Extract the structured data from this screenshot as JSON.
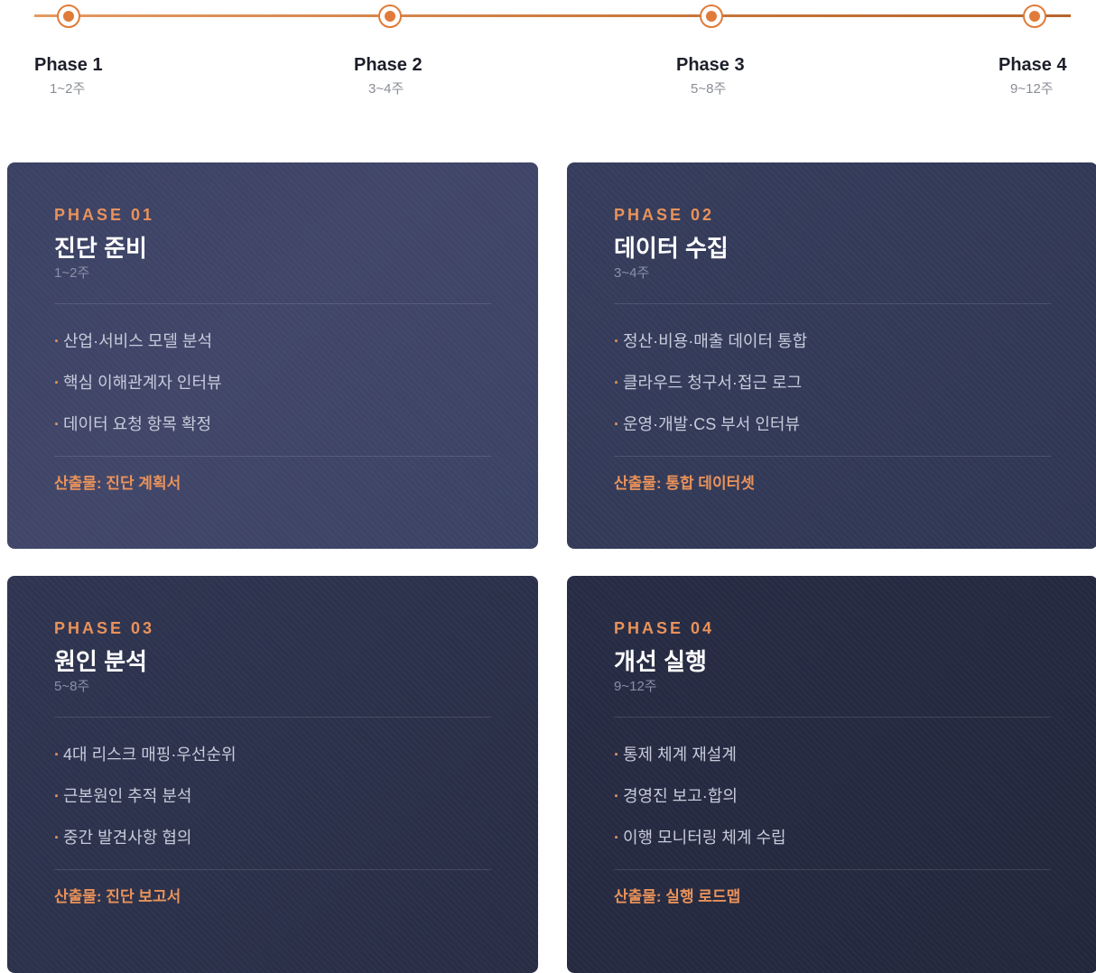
{
  "timeline": {
    "phases": [
      {
        "label": "Phase 1",
        "range": "1~2주"
      },
      {
        "label": "Phase 2",
        "range": "3~4주"
      },
      {
        "label": "Phase 3",
        "range": "5~8주"
      },
      {
        "label": "Phase 4",
        "range": "9~12주"
      }
    ],
    "accent_color": "#e07b39"
  },
  "cards": [
    {
      "tag": "PHASE 01",
      "title": "진단 준비",
      "weeks": "1~2주",
      "items": [
        "산업·서비스 모델 분석",
        "핵심 이해관계자 인터뷰",
        "데이터 요청 항목 확정"
      ],
      "deliverable": "산출물: 진단 계획서"
    },
    {
      "tag": "PHASE 02",
      "title": "데이터 수집",
      "weeks": "3~4주",
      "items": [
        "정산·비용·매출 데이터 통합",
        "클라우드 청구서·접근 로그",
        "운영·개발·CS 부서 인터뷰"
      ],
      "deliverable": "산출물: 통합 데이터셋"
    },
    {
      "tag": "PHASE 03",
      "title": "원인 분석",
      "weeks": "5~8주",
      "items": [
        "4대 리스크 매핑·우선순위",
        "근본원인 추적 분석",
        "중간 발견사항 협의"
      ],
      "deliverable": "산출물: 진단 보고서"
    },
    {
      "tag": "PHASE 04",
      "title": "개선 실행",
      "weeks": "9~12주",
      "items": [
        "통제 체계 재설계",
        "경영진 보고·합의",
        "이행 모니터링 체계 수립"
      ],
      "deliverable": "산출물: 실행 로드맵"
    }
  ]
}
